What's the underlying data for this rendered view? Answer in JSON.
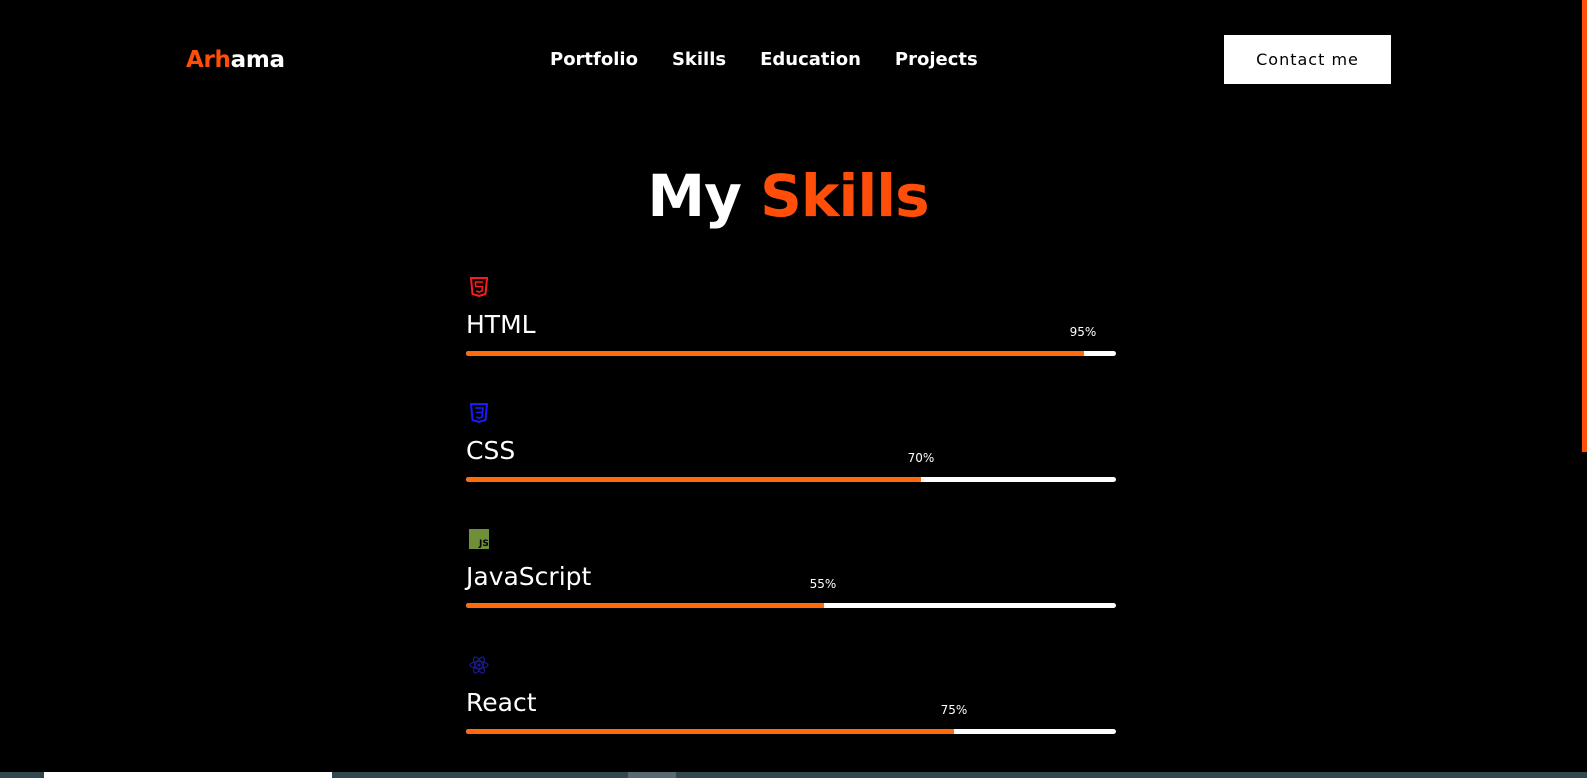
{
  "header": {
    "logo_accent": "Arh",
    "logo_rest": "ama",
    "nav": [
      "Portfolio",
      "Skills",
      "Education",
      "Projects"
    ],
    "contact_label": "Contact me"
  },
  "section": {
    "title_part1": "My",
    "title_part2": "Skills"
  },
  "skills": [
    {
      "name": "HTML",
      "percent_label": "95%",
      "percent": 95,
      "icon": "html5-icon",
      "icon_color": "#ff1a1a"
    },
    {
      "name": "CSS",
      "percent_label": "70%",
      "percent": 70,
      "icon": "css3-icon",
      "icon_color": "#1a1aff"
    },
    {
      "name": "JavaScript",
      "percent_label": "55%",
      "percent": 55,
      "icon": "javascript-icon",
      "icon_color": "#6f8f3a"
    },
    {
      "name": "React",
      "percent_label": "75%",
      "percent": 75,
      "icon": "react-icon",
      "icon_color": "#1a1a8a"
    }
  ],
  "colors": {
    "accent": "#ff4d0a",
    "bar_fill": "#ff6a0a",
    "bar_track": "#ffffff",
    "background": "#000000"
  }
}
